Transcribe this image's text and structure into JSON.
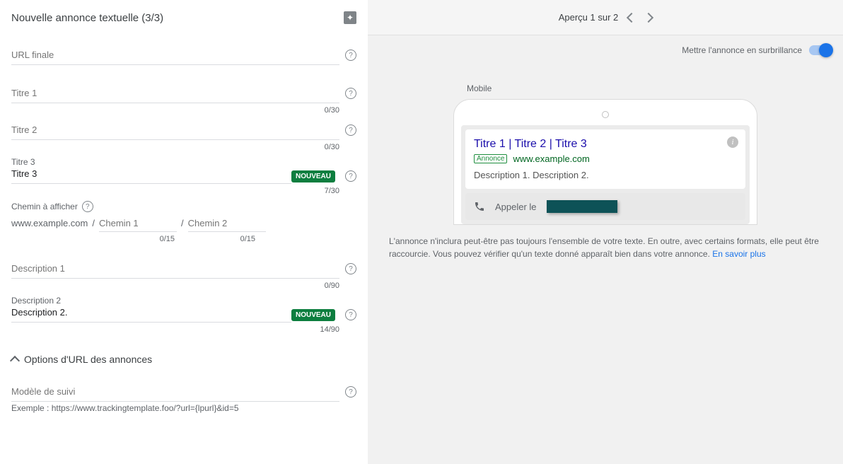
{
  "header": {
    "title": "Nouvelle annonce textuelle (3/3)"
  },
  "fields": {
    "final_url": {
      "label": "URL finale"
    },
    "title1": {
      "label": "Titre 1",
      "counter": "0/30"
    },
    "title2": {
      "label": "Titre 2",
      "counter": "0/30"
    },
    "title3": {
      "label": "Titre 3",
      "value": "Titre 3",
      "counter": "7/30",
      "badge": "NOUVEAU"
    },
    "display_path": {
      "label": "Chemin à afficher",
      "base": "www.example.com",
      "path1_placeholder": "Chemin 1",
      "path2_placeholder": "Chemin 2",
      "counter1": "0/15",
      "counter2": "0/15"
    },
    "desc1": {
      "label": "Description 1",
      "counter": "0/90"
    },
    "desc2": {
      "label": "Description 2",
      "value": "Description 2.",
      "counter": "14/90",
      "badge": "NOUVEAU"
    },
    "url_options": {
      "label": "Options d'URL des annonces"
    },
    "tracking": {
      "label": "Modèle de suivi",
      "example": "Exemple : https://www.trackingtemplate.foo/?url={lpurl}&id=5"
    }
  },
  "preview": {
    "header": "Aperçu 1 sur 2",
    "highlight_label": "Mettre l'annonce en surbrillance",
    "mobile_label": "Mobile",
    "ad": {
      "headline": "Titre 1 | Titre 2 | Titre 3",
      "badge": "Annonce",
      "url": "www.example.com",
      "description": "Description 1. Description 2.",
      "call_label": "Appeler le"
    },
    "disclaimer": "L'annonce n'inclura peut-être pas toujours l'ensemble de votre texte. En outre, avec certains formats, elle peut être raccourcie. Vous pouvez vérifier qu'un texte donné apparaît bien dans votre annonce. ",
    "learn_more": "En savoir plus"
  }
}
